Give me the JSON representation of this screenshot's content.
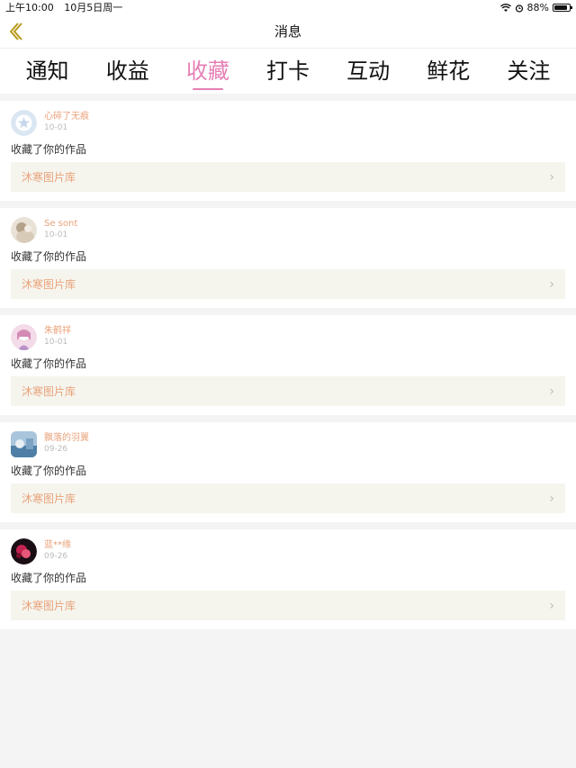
{
  "status": {
    "time": "上午10:00",
    "date": "10月5日周一",
    "battery": "88%",
    "battery_level": 0.88
  },
  "nav": {
    "title": "消息"
  },
  "tabs": [
    {
      "label": "通知",
      "active": false
    },
    {
      "label": "收益",
      "active": false
    },
    {
      "label": "收藏",
      "active": true
    },
    {
      "label": "打卡",
      "active": false
    },
    {
      "label": "互动",
      "active": false
    },
    {
      "label": "鲜花",
      "active": false
    },
    {
      "label": "关注",
      "active": false
    }
  ],
  "notifications": [
    {
      "name": "心碎了无痕",
      "date": "10-01",
      "action": "收藏了你的作品",
      "gallery": "沐寒图片库"
    },
    {
      "name": "Se sont",
      "date": "10-01",
      "action": "收藏了你的作品",
      "gallery": "沐寒图片库"
    },
    {
      "name": "朱鹤祥",
      "date": "10-01",
      "action": "收藏了你的作品",
      "gallery": "沐寒图片库"
    },
    {
      "name": "飘落的羽翼",
      "date": "09-26",
      "action": "收藏了你的作品",
      "gallery": "沐寒图片库"
    },
    {
      "name": "蓝**缘",
      "date": "09-26",
      "action": "收藏了你的作品",
      "gallery": "沐寒图片库"
    }
  ],
  "colors": {
    "accent": "#e67fb5",
    "name": "#e9a27a",
    "panel": "#f5f5ee"
  }
}
